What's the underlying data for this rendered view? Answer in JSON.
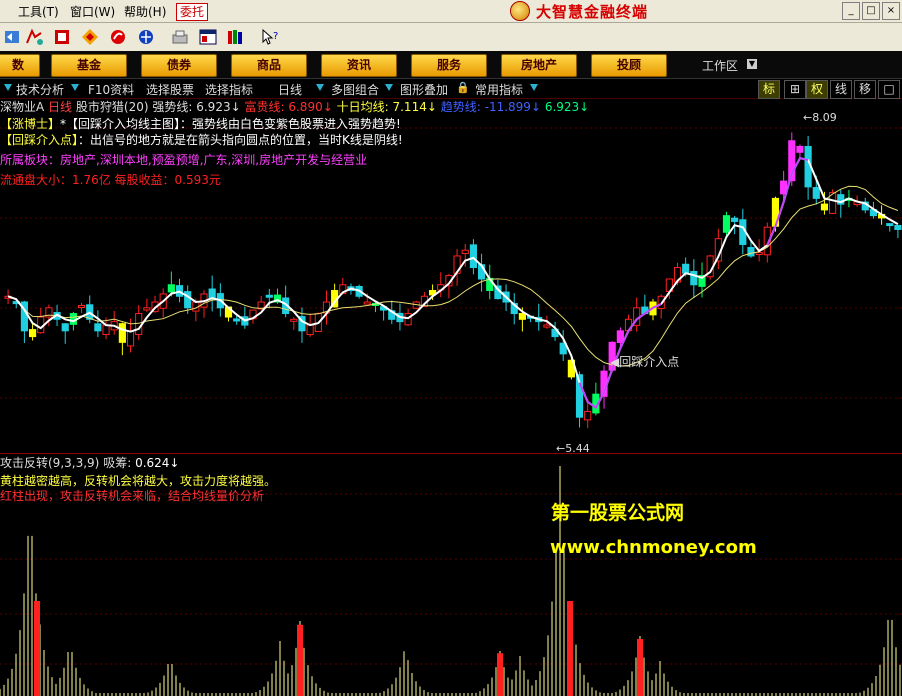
{
  "menu": {
    "items": [
      "工具(T)",
      "窗口(W)",
      "帮助(H)"
    ],
    "entrust_label": "委托",
    "app_title": "大智慧金融终端"
  },
  "window_controls": [
    "_",
    "□",
    "×"
  ],
  "toolbar_icons": [
    "back-icon",
    "layout-icon",
    "stock-icon",
    "diamond-icon",
    "link-icon",
    "web-icon",
    "tray-icon",
    "window-icon",
    "books-icon",
    "help-cursor-icon"
  ],
  "categories": [
    "数",
    "基金",
    "债券",
    "商品",
    "资讯",
    "服务",
    "房地产",
    "投顾"
  ],
  "workarea_label": "工作区",
  "tabs": [
    "技术分析",
    "F10资料",
    "选择股票",
    "选择指标",
    "日线",
    "多图组合",
    "图形叠加",
    "常用指标"
  ],
  "right_buttons": [
    "标",
    "⊞",
    "权",
    "线",
    "移",
    "□"
  ],
  "main_info": {
    "stock": "深物业A",
    "period": "日线",
    "indicator": "股市狩猎(20)",
    "line1_label": "强势线:",
    "line1_value": "6.923↓",
    "line2_label": "富贵线:",
    "line2_value": "6.890↓",
    "line3_label": "十日均线:",
    "line3_value": "7.114↓",
    "line4_label": "趋势线:",
    "line4_value": "-11.899↓",
    "line5_value": "6.923↓",
    "tip1_tag": "【涨博士】",
    "tip1_title": "*【回踩介入均线主图】",
    "tip1_text": "：强势线由白色变紫色股票进入强势趋势!",
    "tip2_tag": "【回踩介入点】",
    "tip2_text": "：出信号的地方就是在箭头指向圆点的位置，当时K线是阴线!",
    "sector": "所属板块：房地产,深圳本地,预盈预增,广东,深圳,房地产开发与经营业",
    "float": "流通盘大小：1.76亿 每股收益：0.593元",
    "high_label": "8.09",
    "low_label": "5.44",
    "signal_label": "回踩介入点"
  },
  "sub_info": {
    "indicator": "攻击反转(9,3,3,9)",
    "field": "吸筹:",
    "value": "0.624↓",
    "note1": "黄柱越密越高，反转机会将越大，攻击力度将越强。",
    "note2": "红柱出现，攻击反转机会来临，结合均线量价分析"
  },
  "watermark": {
    "line1": "第一股票公式网",
    "line2": "www.chnmoney.com"
  },
  "colors": {
    "up": "#ff2020",
    "down": "#20d0e0",
    "strong": "#ff30ff",
    "yellow": "#ffff00",
    "green": "#00ff60",
    "white": "#ffffff"
  },
  "chart_data": {
    "type": "candlestick",
    "price_marks": {
      "high": 8.09,
      "low": 5.44
    },
    "closes": [
      6.6,
      6.55,
      6.3,
      6.25,
      6.42,
      6.5,
      6.4,
      6.3,
      6.45,
      6.52,
      6.4,
      6.3,
      6.35,
      6.38,
      6.2,
      6.3,
      6.45,
      6.5,
      6.55,
      6.62,
      6.7,
      6.6,
      6.5,
      6.55,
      6.62,
      6.58,
      6.5,
      6.42,
      6.4,
      6.35,
      6.48,
      6.55,
      6.6,
      6.55,
      6.45,
      6.4,
      6.3,
      6.35,
      6.45,
      6.55,
      6.65,
      6.7,
      6.65,
      6.6,
      6.55,
      6.52,
      6.48,
      6.4,
      6.38,
      6.45,
      6.55,
      6.6,
      6.65,
      6.7,
      6.78,
      6.95,
      7.0,
      6.85,
      6.75,
      6.65,
      6.58,
      6.55,
      6.45,
      6.4,
      6.42,
      6.38,
      6.35,
      6.25,
      6.1,
      5.9,
      5.55,
      5.6,
      5.75,
      5.95,
      6.2,
      6.3,
      6.4,
      6.5,
      6.45,
      6.55,
      6.6,
      6.75,
      6.85,
      6.8,
      6.7,
      6.78,
      6.95,
      7.1,
      7.3,
      7.25,
      7.05,
      6.95,
      6.98,
      7.2,
      7.45,
      7.6,
      7.95,
      7.85,
      7.55,
      7.45,
      7.35,
      7.5,
      7.4,
      7.45,
      7.42,
      7.35,
      7.3,
      7.28,
      7.22,
      7.18
    ]
  }
}
